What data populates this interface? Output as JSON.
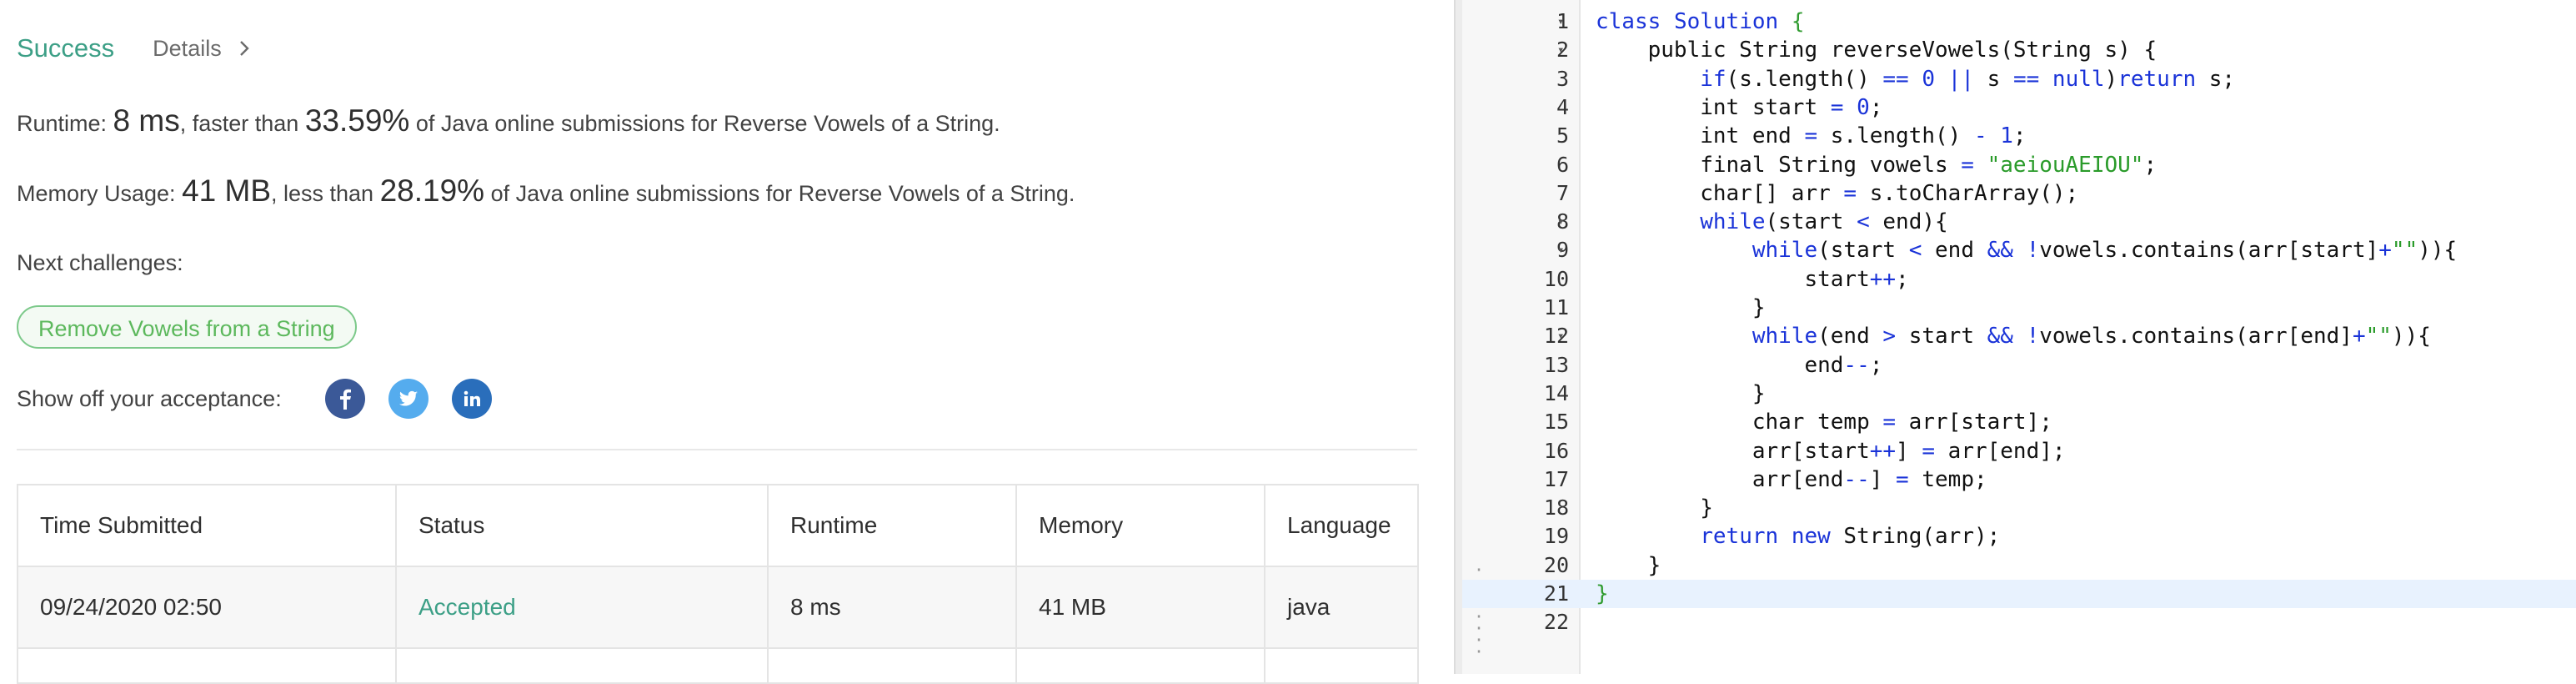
{
  "result": {
    "status": "Success",
    "details_label": "Details"
  },
  "runtime": {
    "label": "Runtime: ",
    "value": "8 ms",
    "mid": ", faster than ",
    "percent": "33.59%",
    "tail": " of Java online submissions for Reverse Vowels of a String."
  },
  "memory": {
    "label": "Memory Usage: ",
    "value": "41 MB",
    "mid": ", less than ",
    "percent": "28.19%",
    "tail": " of Java online submissions for Reverse Vowels of a String."
  },
  "next": {
    "label": "Next challenges:",
    "challenge": "Remove Vowels from a String"
  },
  "share": {
    "label": "Show off your acceptance:",
    "icons": [
      "facebook-icon",
      "twitter-icon",
      "linkedin-icon"
    ]
  },
  "submissions": {
    "headers": [
      "Time Submitted",
      "Status",
      "Runtime",
      "Memory",
      "Language"
    ],
    "rows": [
      [
        "09/24/2020 02:50",
        "Accepted",
        "8 ms",
        "41 MB",
        "java"
      ]
    ]
  },
  "editor": {
    "active_line": 21,
    "lines": [
      "class Solution {",
      "    public String reverseVowels(String s) {",
      "        if(s.length() == 0 || s == null)return s;",
      "        int start = 0;",
      "        int end = s.length() - 1;",
      "        final String vowels = \"aeiouAEIOU\";",
      "        char[] arr = s.toCharArray();",
      "        while(start < end){",
      "            while(start < end && !vowels.contains(arr[start]+\"\")){",
      "                start++;",
      "            }",
      "            while(end > start && !vowels.contains(arr[end]+\"\")){",
      "                end--;",
      "            }",
      "            char temp = arr[start];",
      "            arr[start++] = arr[end];",
      "            arr[end--] = temp;",
      "        }",
      "        return new String(arr);",
      "    }",
      "}",
      ""
    ],
    "fold_lines": [
      1,
      2,
      8,
      9,
      12
    ]
  },
  "colors": {
    "success": "#3c9f86",
    "pill_border": "#7cc98a",
    "facebook": "#3b5998",
    "twitter": "#55acee",
    "linkedin": "#2a6ebb",
    "keyword": "#1a33d8",
    "string": "#2a9b2a"
  }
}
